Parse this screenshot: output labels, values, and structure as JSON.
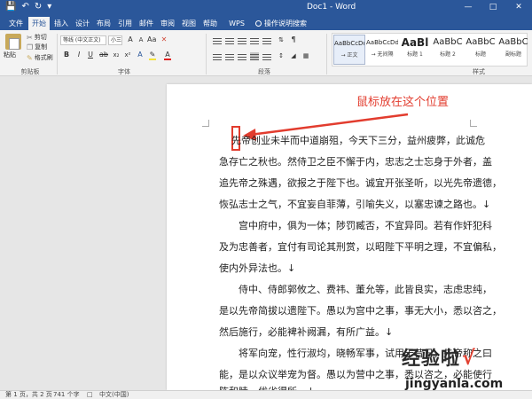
{
  "titlebar": {
    "doc_title": "Doc1 - Word",
    "qa_icons": [
      "save-icon",
      "undo-icon",
      "redo-icon",
      "customize-icon"
    ],
    "window_controls": [
      "minimize-icon",
      "restore-icon",
      "close-icon"
    ],
    "color": "#2b579a"
  },
  "tabs": [
    "文件",
    "开始",
    "插入",
    "设计",
    "布局",
    "引用",
    "邮件",
    "审阅",
    "视图",
    "帮助",
    "WPS PDF"
  ],
  "tell_me": "操作说明搜索",
  "active_tab": "开始",
  "ribbon": {
    "clipboard": {
      "paste": "粘贴",
      "cut": "剪切",
      "copy": "复制",
      "format_painter": "格式刷",
      "label": "剪贴板"
    },
    "font": {
      "name": "等线 (中文正文)",
      "size": "小三",
      "label": "字体"
    },
    "paragraph": {
      "label": "段落"
    },
    "styles": {
      "label": "样式",
      "items": [
        {
          "sample": "AaBbCcDd",
          "name": "→ 正文"
        },
        {
          "sample": "AaBbCcDd",
          "name": "→ 无间隔"
        },
        {
          "sample": "AaBl",
          "name": "标题 1"
        },
        {
          "sample": "AaBbC",
          "name": "标题 2"
        },
        {
          "sample": "AaBbC",
          "name": "标题"
        },
        {
          "sample": "AaBbC",
          "name": "副标题"
        }
      ]
    }
  },
  "annotation": {
    "text": "鼠标放在这个位置",
    "color": "#e23c2e"
  },
  "document": {
    "lines": [
      "先帝创业未半而中道崩殂，今天下三分，益州疲弊，此诚危",
      "急存亡之秋也。然侍卫之臣不懈于内，忠志之士忘身于外者，盖",
      "追先帝之殊遇，欲报之于陛下也。诚宜开张圣听，以光先帝遗德，",
      "恢弘志士之气，不宜妄自菲薄，引喻失义，以塞忠谏之路也。↓",
      "宫中府中，俱为一体；陟罚臧否，不宜异同。若有作奸犯科",
      "及为忠善者，宜付有司论其刑赏，以昭陛下平明之理，不宜偏私，",
      "使内外异法也。↓",
      "侍中、侍郎郭攸之、费祎、董允等，此皆良实，志虑忠纯，",
      "是以先帝简拔以遗陛下。愚以为宫中之事，事无大小，悉以咨之，",
      "然后施行，必能裨补阙漏，有所广益。↓",
      "将军向宠，性行淑均，晓畅军事，试用于昔日，先帝称之曰",
      "能，是以众议举宠为督。愚以为营中之事，悉以咨之，必能使行",
      "阵和睦，优劣得所。↓"
    ]
  },
  "watermark": {
    "text": "经验啦",
    "check": "√",
    "url": "jingyanla.com"
  },
  "status": {
    "page": "第 1 页，共 2 页",
    "words": "741 个字",
    "lang": "中文(中国)"
  }
}
